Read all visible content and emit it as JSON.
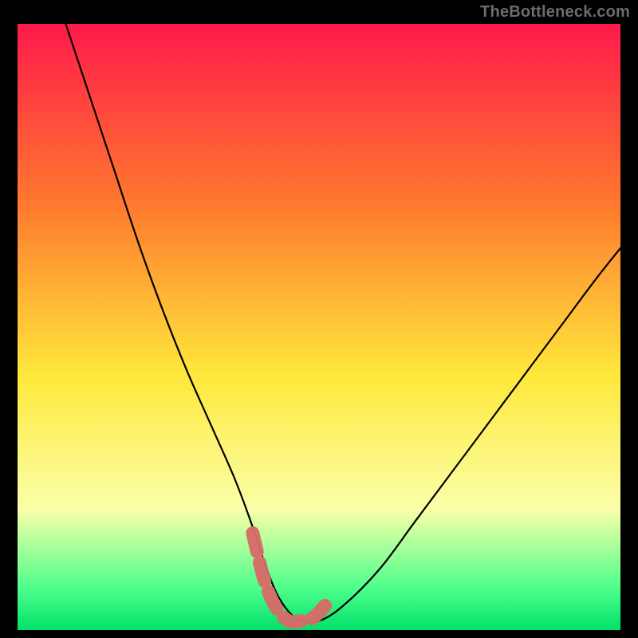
{
  "watermark": "TheBottleneck.com",
  "colors": {
    "black": "#000000",
    "curve": "#000000",
    "overlay": "#d66b68",
    "grad_top": "#ff1a4b",
    "grad_mid_upper": "#ff7a2e",
    "grad_mid": "#ffe83b",
    "grad_mid_lower": "#faffa8",
    "grad_lower": "#4fff8c",
    "grad_bottom": "#02e06a"
  },
  "chart_data": {
    "type": "line",
    "title": "",
    "xlabel": "",
    "ylabel": "",
    "xlim": [
      0,
      100
    ],
    "ylim": [
      0,
      100
    ],
    "series": [
      {
        "name": "bottleneck-curve",
        "x": [
          8,
          12,
          16,
          20,
          24,
          28,
          32,
          36,
          39,
          41,
          43,
          45,
          47,
          50,
          54,
          60,
          66,
          72,
          78,
          84,
          90,
          96,
          100
        ],
        "y": [
          100,
          88,
          76,
          64,
          53,
          43,
          34,
          25,
          17,
          11,
          6,
          3,
          1.5,
          1.5,
          4,
          10,
          18,
          26,
          34,
          42,
          50,
          58,
          63
        ]
      },
      {
        "name": "overlay-band",
        "x": [
          39,
          41,
          43,
          45,
          47,
          49,
          51
        ],
        "y": [
          16,
          8,
          3.5,
          1.5,
          1.5,
          2,
          4
        ]
      }
    ],
    "gradient_stops": [
      {
        "pct": 0,
        "color": "#ff1a4b"
      },
      {
        "pct": 30,
        "color": "#ff7a2e"
      },
      {
        "pct": 58,
        "color": "#ffe83b"
      },
      {
        "pct": 80,
        "color": "#faffa8"
      },
      {
        "pct": 93,
        "color": "#4fff8c"
      },
      {
        "pct": 100,
        "color": "#02e06a"
      }
    ]
  }
}
